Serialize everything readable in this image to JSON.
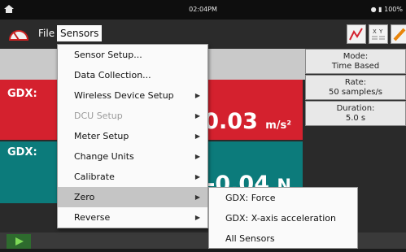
{
  "status": {
    "time": "02:04PM",
    "battery": "100%"
  },
  "menubar": {
    "file": "File",
    "sensors": "Sensors"
  },
  "panel": {
    "mode_label": "Mode:",
    "mode_value": "Time Based",
    "rate_label": "Rate:",
    "rate_value": "50 samples/s",
    "duration_label": "Duration:",
    "duration_value": "5.0 s"
  },
  "meters": [
    {
      "label": "GDX:",
      "value": "0.03",
      "unit": "m/s²"
    },
    {
      "label": "GDX:",
      "value": "-0.04",
      "unit": "N"
    }
  ],
  "sensors_menu": [
    {
      "label": "Sensor Setup...",
      "submenu": false,
      "disabled": false
    },
    {
      "label": "Data Collection...",
      "submenu": false,
      "disabled": false
    },
    {
      "label": "Wireless Device Setup",
      "submenu": true,
      "disabled": false
    },
    {
      "label": "DCU Setup",
      "submenu": true,
      "disabled": true
    },
    {
      "label": "Meter Setup",
      "submenu": true,
      "disabled": false
    },
    {
      "label": "Change Units",
      "submenu": true,
      "disabled": false
    },
    {
      "label": "Calibrate",
      "submenu": true,
      "disabled": false
    },
    {
      "label": "Zero",
      "submenu": true,
      "disabled": false,
      "highlighted": true
    },
    {
      "label": "Reverse",
      "submenu": true,
      "disabled": false
    }
  ],
  "zero_submenu": [
    "GDX: Force",
    "GDX: X-axis acceleration",
    "All Sensors"
  ],
  "colors": {
    "meter1": "#d4212e",
    "meter2": "#0c7b7b",
    "play": "#2e6b2e"
  }
}
